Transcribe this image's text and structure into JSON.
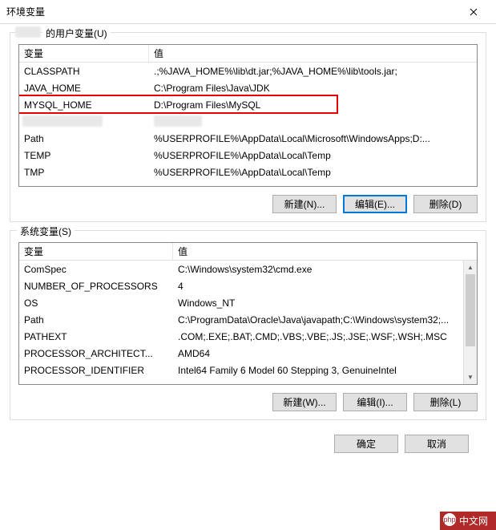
{
  "title": "环境变量",
  "user_section": {
    "label": "的用户变量(U)",
    "header_name": "变量",
    "header_value": "值",
    "rows": [
      {
        "name": "CLASSPATH",
        "value": ".;%JAVA_HOME%\\lib\\dt.jar;%JAVA_HOME%\\lib\\tools.jar;"
      },
      {
        "name": "JAVA_HOME",
        "value": "C:\\Program Files\\Java\\JDK"
      },
      {
        "name": "MYSQL_HOME",
        "value": "D:\\Program Files\\MySQL"
      },
      {
        "name": "",
        "value": ""
      },
      {
        "name": "Path",
        "value": "%USERPROFILE%\\AppData\\Local\\Microsoft\\WindowsApps;D:..."
      },
      {
        "name": "TEMP",
        "value": "%USERPROFILE%\\AppData\\Local\\Temp"
      },
      {
        "name": "TMP",
        "value": "%USERPROFILE%\\AppData\\Local\\Temp"
      }
    ],
    "buttons": {
      "new": "新建(N)...",
      "edit": "编辑(E)...",
      "delete": "删除(D)"
    }
  },
  "system_section": {
    "label": "系统变量(S)",
    "header_name": "变量",
    "header_value": "值",
    "rows": [
      {
        "name": "ComSpec",
        "value": "C:\\Windows\\system32\\cmd.exe"
      },
      {
        "name": "NUMBER_OF_PROCESSORS",
        "value": "4"
      },
      {
        "name": "OS",
        "value": "Windows_NT"
      },
      {
        "name": "Path",
        "value": "C:\\ProgramData\\Oracle\\Java\\javapath;C:\\Windows\\system32;..."
      },
      {
        "name": "PATHEXT",
        "value": ".COM;.EXE;.BAT;.CMD;.VBS;.VBE;.JS;.JSE;.WSF;.WSH;.MSC"
      },
      {
        "name": "PROCESSOR_ARCHITECT...",
        "value": "AMD64"
      },
      {
        "name": "PROCESSOR_IDENTIFIER",
        "value": "Intel64 Family 6 Model 60 Stepping 3, GenuineIntel"
      }
    ],
    "buttons": {
      "new": "新建(W)...",
      "edit": "编辑(I)...",
      "delete": "删除(L)"
    }
  },
  "footer": {
    "ok": "确定",
    "cancel": "取消"
  },
  "logo": "中文网"
}
